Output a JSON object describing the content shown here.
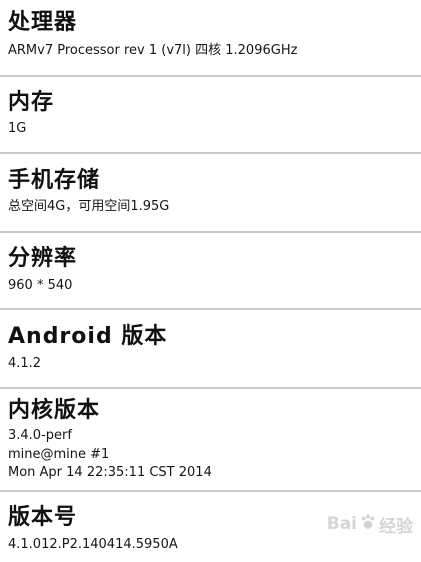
{
  "specs": [
    {
      "title": "处理器",
      "lines": [
        "ARMv7 Processor rev 1 (v7l) 四核 1.2096GHz"
      ]
    },
    {
      "title": "内存",
      "lines": [
        "1G"
      ]
    },
    {
      "title": "手机存储",
      "lines": [
        "总空间4G，可用空间1.95G"
      ]
    },
    {
      "title": "分辨率",
      "lines": [
        "960 * 540"
      ]
    },
    {
      "title": "Android 版本",
      "lines": [
        "4.1.2"
      ]
    },
    {
      "title": "内核版本",
      "lines": [
        "3.4.0-perf",
        "mine@mine #1",
        "Mon Apr 14 22:35:11 CST 2014"
      ]
    },
    {
      "title": "版本号",
      "lines": [
        "4.1.012.P2.140414.5950A"
      ]
    }
  ],
  "watermark": {
    "text_left": "Bai",
    "text_right": "经验",
    "icon": "paw-icon"
  },
  "colors": {
    "background": "#ffffff",
    "separator": "#c9c9c9",
    "text": "#111111"
  }
}
